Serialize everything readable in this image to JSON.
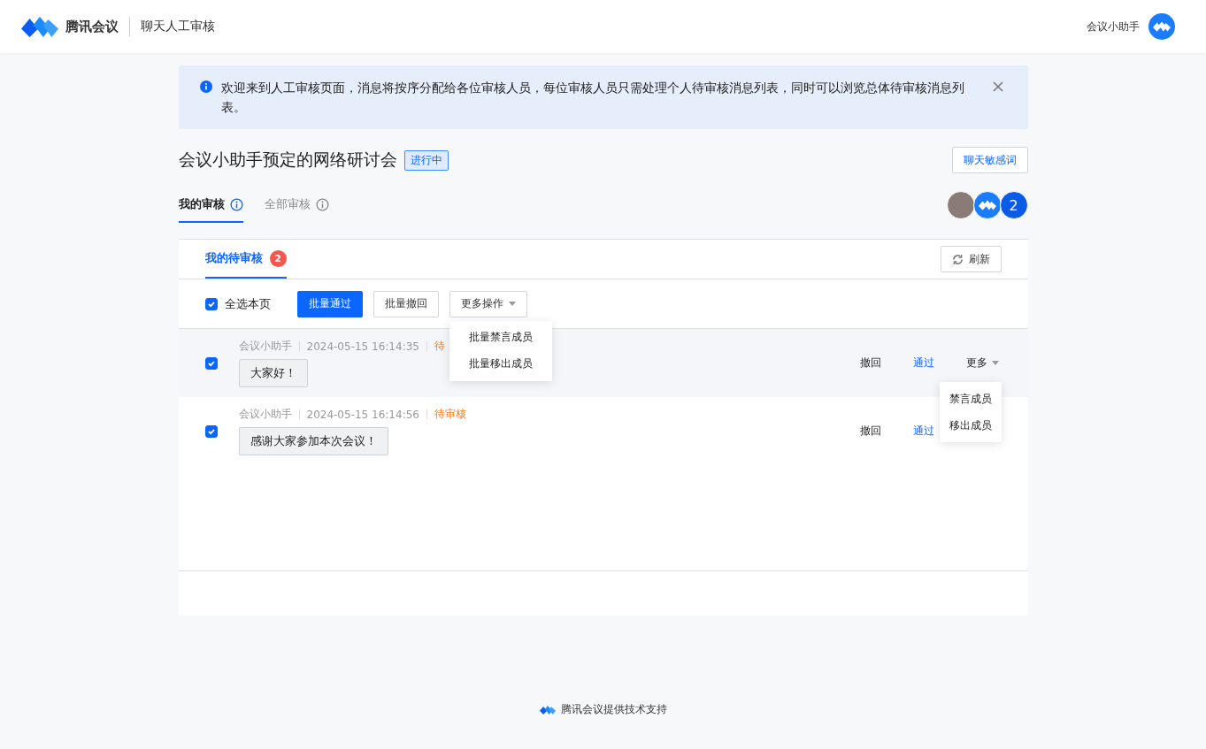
{
  "header": {
    "brand": "腾讯会议",
    "page_title": "聊天人工审核",
    "user_name": "会议小助手"
  },
  "notice": {
    "text": "欢迎来到人工审核页面，消息将按序分配给各位审核人员，每位审核人员只需处理个人待审核消息列表，同时可以浏览总体待审核消息列表。"
  },
  "meeting": {
    "title": "会议小助手预定的网络研讨会",
    "status": "进行中",
    "sensitive_button": "聊天敏感词"
  },
  "tabs": [
    {
      "label": "我的审核",
      "selected": true
    },
    {
      "label": "全部审核",
      "selected": false
    }
  ],
  "reviewers": {
    "count": "2"
  },
  "panel": {
    "tab": {
      "label": "我的待审核",
      "badge": "2",
      "selected": true
    },
    "refresh": "刷新"
  },
  "toolbar": {
    "select_all": {
      "label": "全选本页",
      "checked": true
    },
    "approve": "批量通过",
    "withdraw": "批量撤回",
    "more": "更多操作",
    "menu_open": true,
    "menu": [
      "批量禁言成员",
      "批量移出成员"
    ]
  },
  "messages": [
    {
      "sender": "会议小助手",
      "time": "2024-05-15 16:14:35",
      "status": "待",
      "text": "大家好！",
      "checked": true,
      "hovered": true,
      "withdraw": "撤回",
      "approve": "通过",
      "more": "更多",
      "menu_open": true,
      "menu": [
        "禁言成员",
        "移出成员"
      ]
    },
    {
      "sender": "会议小助手",
      "time": "2024-05-15 16:14:56",
      "status": "待审核",
      "text": "感谢大家参加本次会议！",
      "checked": true,
      "hovered": false,
      "withdraw": "撤回",
      "approve": "通过",
      "menu_open": false
    }
  ],
  "footer": {
    "text": "腾讯会议提供技术支持"
  }
}
